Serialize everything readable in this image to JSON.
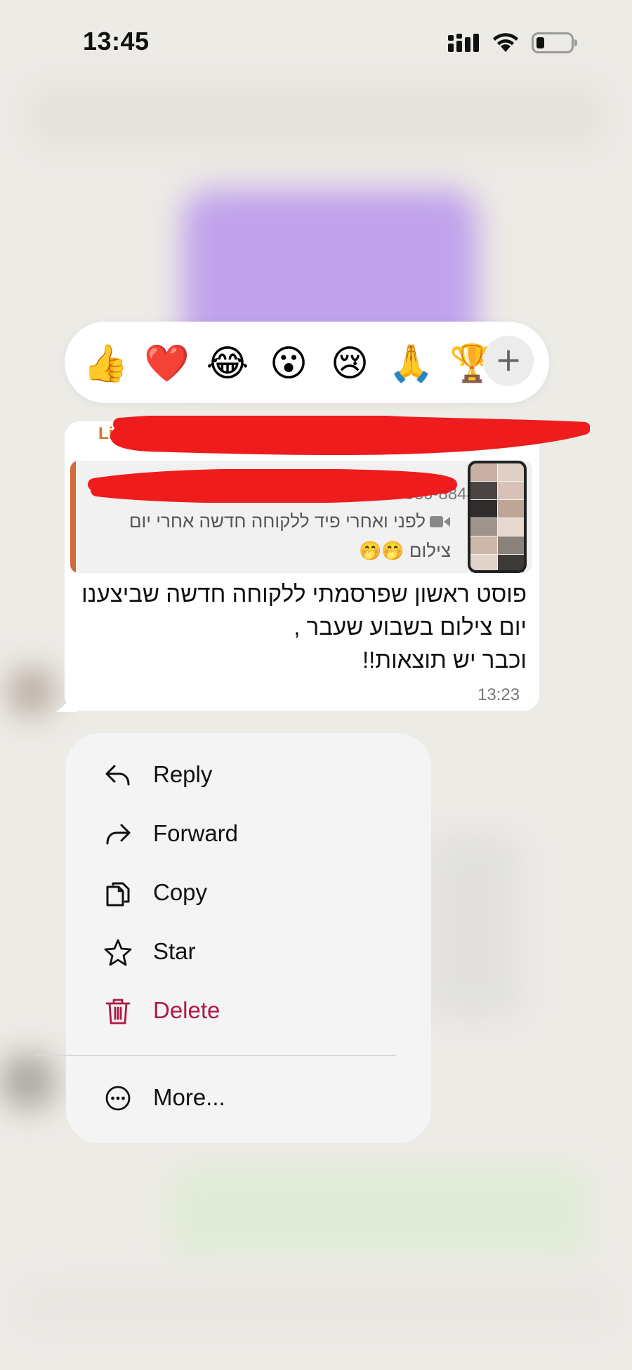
{
  "status_bar": {
    "time": "13:45"
  },
  "reactions": {
    "emojis": [
      "👍",
      "❤️",
      "😂",
      "😮",
      "😢",
      "🙏",
      "🏆"
    ],
    "add_label": "+"
  },
  "message": {
    "sender_name": "Lily",
    "sender_phone": "00-8848",
    "quoted": {
      "phone": "4-536-8848",
      "text": "לפני ואחרי פיד ללקוחה חדשה אחרי יום צילום 🤭🤭"
    },
    "body": "פוסט ראשון שפרסמתי ללקוחה חדשה שביצענו יום צילום בשבוע שעבר ,\nוכבר יש תוצאות!!",
    "time": "13:23"
  },
  "menu": {
    "items": [
      {
        "label": "Reply",
        "icon": "reply-icon"
      },
      {
        "label": "Forward",
        "icon": "forward-icon"
      },
      {
        "label": "Copy",
        "icon": "copy-icon"
      },
      {
        "label": "Star",
        "icon": "star-icon"
      },
      {
        "label": "Delete",
        "icon": "trash-icon"
      },
      {
        "label": "More...",
        "icon": "more-icon"
      }
    ]
  },
  "colors": {
    "delete": "#b01945",
    "sender": "#d9742d",
    "quote_bar": "#d16b3a",
    "redaction": "#ee1c1c"
  }
}
